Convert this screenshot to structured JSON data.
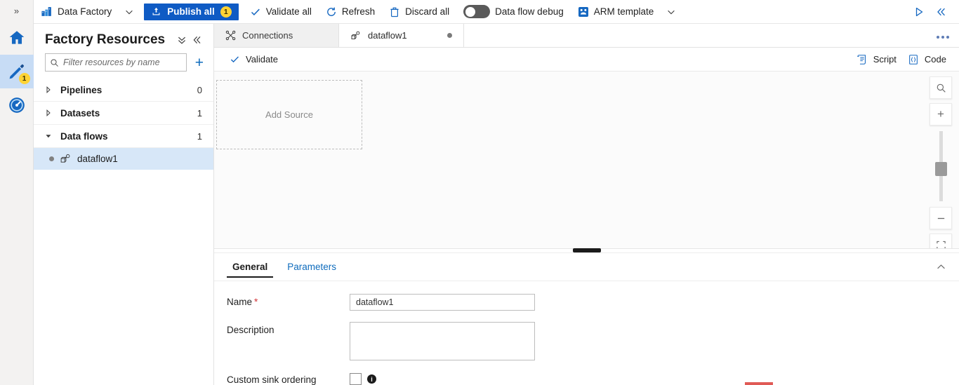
{
  "rail": {
    "expand_label": "»",
    "items": [
      {
        "name": "home",
        "icon": "home-icon",
        "badge": ""
      },
      {
        "name": "author",
        "icon": "pencil-icon",
        "badge": "1"
      },
      {
        "name": "monitor",
        "icon": "monitor-gauge-icon",
        "badge": ""
      }
    ]
  },
  "toolbar": {
    "product_label": "Data Factory",
    "product_caret": "chevron-down-icon",
    "publish_label": "Publish all",
    "publish_badge": "1",
    "validate_all_label": "Validate all",
    "refresh_label": "Refresh",
    "discard_all_label": "Discard all",
    "data_flow_debug_label": "Data flow debug",
    "data_flow_debug_state": "off",
    "arm_template_label": "ARM template",
    "arm_caret": "chevron-down-icon",
    "run_icon": "play-triangle-icon",
    "collapse_icon": "double-chevron-left-icon"
  },
  "resources": {
    "title": "Factory Resources",
    "collapse_all_icon": "double-chevron-down-icon",
    "collapse_panel_icon": "double-chevron-left-icon",
    "filter_placeholder": "Filter resources by name",
    "filter_value": "",
    "add_label": "+",
    "tree": [
      {
        "label": "Pipelines",
        "count": "0",
        "expanded": false
      },
      {
        "label": "Datasets",
        "count": "1",
        "expanded": false
      },
      {
        "label": "Data flows",
        "count": "1",
        "expanded": true
      }
    ],
    "selected_item": {
      "label": "dataflow1",
      "icon": "data-flow-icon"
    }
  },
  "tabs": [
    {
      "label": "Connections",
      "icon": "connections-icon",
      "active": false,
      "dirty": false
    },
    {
      "label": "dataflow1",
      "icon": "data-flow-icon",
      "active": true,
      "dirty": true
    }
  ],
  "tab_overflow": "more-options-icon",
  "actionbar": {
    "validate_label": "Validate",
    "script_label": "Script",
    "code_label": "Code"
  },
  "canvas": {
    "add_source_label": "Add Source",
    "zoom_search_icon": "search-icon",
    "zoom_in_label": "+",
    "zoom_out_label": "—",
    "fit_icon": "fit-to-screen-icon"
  },
  "properties": {
    "subtabs": [
      {
        "label": "General",
        "active": true
      },
      {
        "label": "Parameters",
        "active": false
      }
    ],
    "collapse_icon": "chevron-up-icon",
    "fields": {
      "name_label": "Name",
      "name_required": "*",
      "name_value": "dataflow1",
      "description_label": "Description",
      "description_value": "",
      "custom_sink_ordering_label": "Custom sink ordering",
      "custom_sink_ordering_checked": false,
      "custom_sink_ordering_info": "info-icon"
    }
  },
  "colors": {
    "accent": "#0f6cbd",
    "publish_blue": "#0f5bc4",
    "badge_yellow": "#ffd335",
    "selection_blue": "#d7e7f8",
    "required_red": "#d13438"
  }
}
